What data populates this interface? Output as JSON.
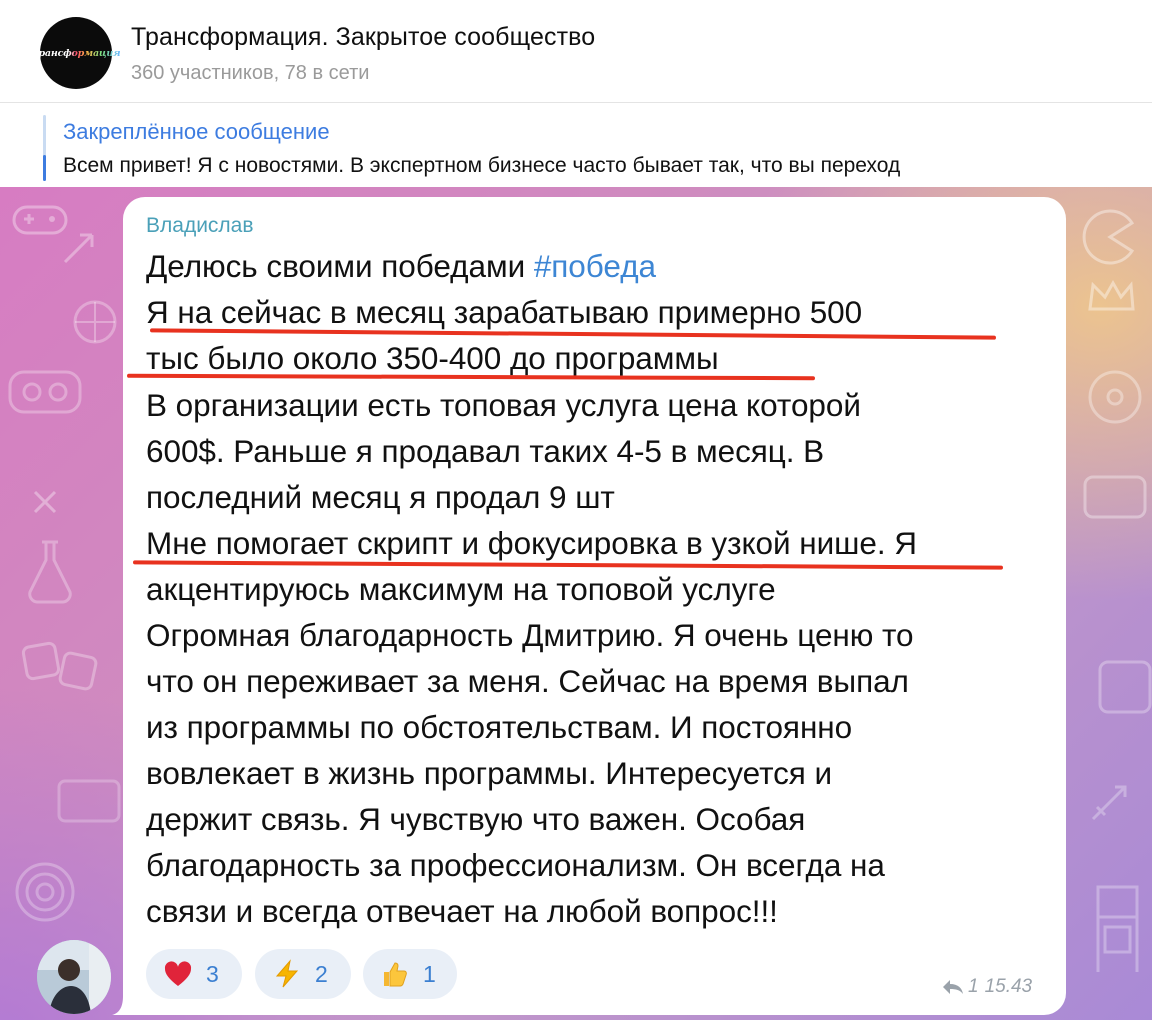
{
  "header": {
    "logo_text": "Трансформация",
    "title": "Трансформация. Закрытое сообщество",
    "subtitle": "360 участников, 78 в сети"
  },
  "pinned": {
    "title": "Закреплённое сообщение",
    "text": "Всем привет! Я с новостями.  В экспертном бизнесе часто бывает так, что вы переход"
  },
  "message": {
    "sender": "Владислав",
    "lines": [
      {
        "text": "Делюсь своими победами ",
        "tag": "#победа"
      },
      {
        "text": "Я на сейчас в месяц зарабатываю примерно 500"
      },
      {
        "text": "тыс было около 350-400 до программы"
      },
      {
        "text": "В организации есть топовая услуга цена которой"
      },
      {
        "text": "600$. Раньше я продавал таких 4-5 в месяц. В"
      },
      {
        "text": "последний месяц я продал 9 шт"
      },
      {
        "text": "Мне помогает скрипт и фокусировка в узкой нише. Я"
      },
      {
        "text": "акцентируюсь максимум на топовой услуге"
      },
      {
        "text": "Огромная благодарность Дмитрию. Я очень ценю то"
      },
      {
        "text": "что он переживает за меня. Сейчас на время выпал"
      },
      {
        "text": "из программы по обстоятельствам. И постоянно"
      },
      {
        "text": "вовлекает в жизнь программы. Интересуется и"
      },
      {
        "text": "держит связь. Я чувствую что важен. Особая"
      },
      {
        "text": "благодарность за профессионализм. Он всегда на"
      },
      {
        "text": "связи и всегда отвечает на любой вопрос!!!"
      }
    ],
    "reactions": [
      {
        "emoji": "heart-icon",
        "count": "3"
      },
      {
        "emoji": "lightning-icon",
        "count": "2"
      },
      {
        "emoji": "thumbs-up-icon",
        "count": "1"
      }
    ],
    "forward_count": "1",
    "time": "15.43"
  },
  "colors": {
    "accent": "#3d7ce0",
    "sender": "#4aa0b8",
    "underline": "#e8321f",
    "reaction_bg": "#e9eff7"
  }
}
